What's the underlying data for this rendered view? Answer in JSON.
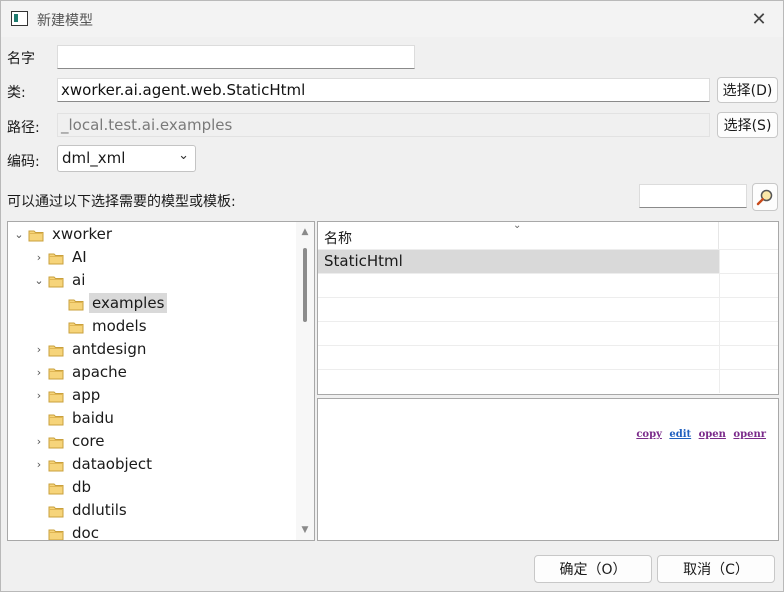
{
  "window": {
    "title": "新建模型",
    "close_glyph": "✕"
  },
  "form": {
    "name_label": "名字",
    "name_value": "",
    "class_label": "类:",
    "class_value": "xworker.ai.agent.web.StaticHtml",
    "class_select_button": "选择(D)",
    "path_label": "路径:",
    "path_value": "_local.test.ai.examples",
    "path_select_button": "选择(S)",
    "encoding_label": "编码:",
    "encoding_value": "dml_xml"
  },
  "template_hint": "可以通过以下选择需要的模型或模板:",
  "search": {
    "value": ""
  },
  "tree": {
    "items": [
      {
        "label": "xworker",
        "expanded": true,
        "has_children": true
      },
      {
        "label": "AI",
        "expanded": false,
        "has_children": true
      },
      {
        "label": "ai",
        "expanded": true,
        "has_children": true
      },
      {
        "label": "examples",
        "expanded": false,
        "has_children": false,
        "selected": true
      },
      {
        "label": "models",
        "expanded": false,
        "has_children": false
      },
      {
        "label": "antdesign",
        "expanded": false,
        "has_children": true
      },
      {
        "label": "apache",
        "expanded": false,
        "has_children": true
      },
      {
        "label": "app",
        "expanded": false,
        "has_children": true
      },
      {
        "label": "baidu",
        "expanded": false,
        "has_children": false
      },
      {
        "label": "core",
        "expanded": false,
        "has_children": true
      },
      {
        "label": "dataobject",
        "expanded": false,
        "has_children": true
      },
      {
        "label": "db",
        "expanded": false,
        "has_children": false
      },
      {
        "label": "ddlutils",
        "expanded": false,
        "has_children": false
      },
      {
        "label": "doc",
        "expanded": false,
        "has_children": false
      }
    ]
  },
  "table": {
    "header": "名称",
    "rows": [
      "StaticHtml",
      "",
      "",
      "",
      "",
      ""
    ]
  },
  "links": {
    "copy": "copy",
    "edit": "edit",
    "open": "open",
    "openr": "openr"
  },
  "footer": {
    "ok": "确定（O）",
    "cancel": "取消（C）"
  }
}
